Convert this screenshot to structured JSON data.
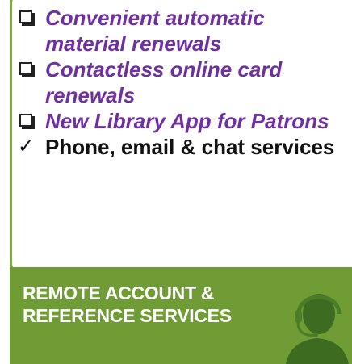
{
  "checklist": [
    {
      "status": "pending",
      "icon": "checkbox-icon",
      "text": "Convenient automatic material renewals"
    },
    {
      "status": "pending",
      "icon": "checkbox-icon",
      "text": "Contactless online card renewals"
    },
    {
      "status": "pending",
      "icon": "checkbox-icon",
      "text": "New Library App for Patrons"
    },
    {
      "status": "done",
      "icon": "checkmark-icon",
      "text": "Phone, email & chat services",
      "mark": "✓"
    }
  ],
  "banner": {
    "title_line1": "REMOTE ACCOUNT &",
    "title_line2": "REFERENCE SERVICES",
    "icon": "headset-agent-icon"
  },
  "colors": {
    "accent_green": "#6f9c35",
    "pending_purple": "#7030a0",
    "dark_green": "#3d6b1f"
  }
}
